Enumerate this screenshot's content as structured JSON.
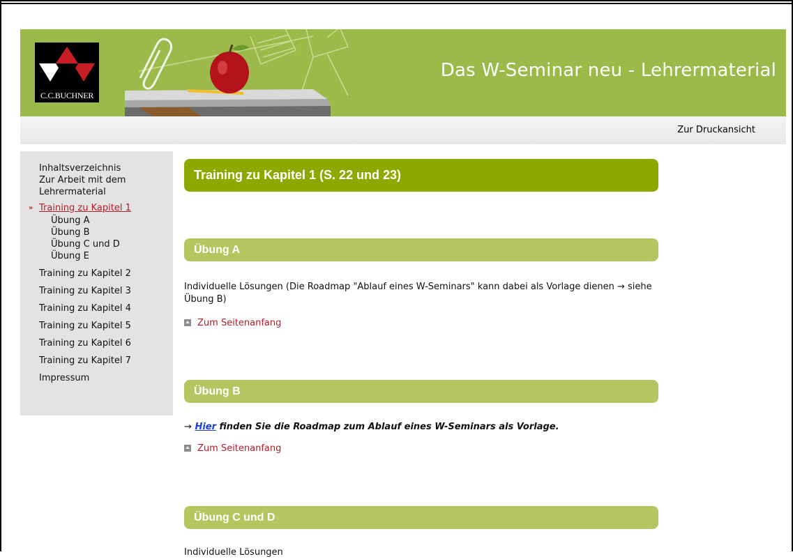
{
  "header": {
    "title": "Das W-Seminar neu - Lehrermaterial",
    "logo_text": "C.C.BUCHNER",
    "print_link": "Zur Druckansicht"
  },
  "sidebar": {
    "items": [
      {
        "label": "Inhaltsverzeichnis"
      },
      {
        "label": "Zur Arbeit mit dem Lehrermaterial"
      },
      {
        "label": "Training zu Kapitel 1",
        "active": true
      },
      {
        "label": "Übung A",
        "sub": true
      },
      {
        "label": "Übung B",
        "sub": true
      },
      {
        "label": "Übung C und D",
        "sub": true
      },
      {
        "label": "Übung E",
        "sub": true
      },
      {
        "label": "Training zu Kapitel 2"
      },
      {
        "label": "Training zu Kapitel 3"
      },
      {
        "label": "Training zu Kapitel 4"
      },
      {
        "label": "Training zu Kapitel 5"
      },
      {
        "label": "Training zu Kapitel 6"
      },
      {
        "label": "Training zu Kapitel 7"
      },
      {
        "label": "Impressum"
      }
    ]
  },
  "main": {
    "title": "Training zu Kapitel 1 (S. 22 und 23)",
    "sections": [
      {
        "heading": "Übung A",
        "text": "Individuelle Lösungen (Die Roadmap \"Ablauf eines W-Seminars\" kann dabei als Vorlage dienen → siehe Übung B)",
        "top_link": "Zum Seitenanfang"
      },
      {
        "heading": "Übung B",
        "arrow": "→",
        "link_text": "Hier",
        "text_after": " finden Sie die Roadmap zum Ablauf eines W-Seminars als Vorlage.",
        "top_link": "Zum Seitenanfang"
      },
      {
        "heading": "Übung C und D",
        "text": "Individuelle Lösungen"
      }
    ]
  },
  "colors": {
    "banner": "#9cba4a",
    "main_heading": "#8ea800",
    "section_heading": "#b3c660",
    "link_red": "#b21e28",
    "link_blue": "#1a3ee0"
  },
  "icons": [
    "top-arrow-icon",
    "active-marker-icon",
    "apple-icon",
    "paperclip-icon"
  ]
}
